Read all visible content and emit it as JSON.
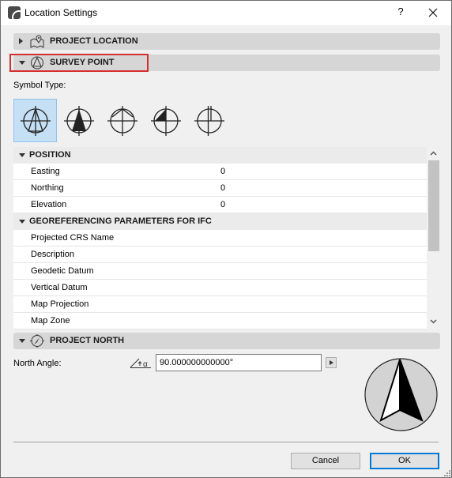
{
  "window": {
    "title": "Location Settings",
    "help_label": "?",
    "close_label": "✕"
  },
  "sections": {
    "project_location": {
      "label": "PROJECT LOCATION",
      "expanded": false,
      "icon": "map-pin-icon"
    },
    "survey_point": {
      "label": "SURVEY POINT",
      "expanded": true,
      "icon": "survey-point-icon",
      "highlighted": true
    },
    "project_north": {
      "label": "PROJECT NORTH",
      "expanded": true,
      "icon": "compass-icon"
    }
  },
  "symbol_type": {
    "label": "Symbol Type:",
    "selected_index": 0,
    "options": [
      {
        "name": "symbol-outline-triangle"
      },
      {
        "name": "symbol-filled-triangle"
      },
      {
        "name": "symbol-roof"
      },
      {
        "name": "symbol-quarter-filled"
      },
      {
        "name": "symbol-double-line"
      }
    ]
  },
  "table": {
    "groups": [
      {
        "label": "POSITION",
        "rows": [
          {
            "name": "Easting",
            "value": "0"
          },
          {
            "name": "Northing",
            "value": "0"
          },
          {
            "name": "Elevation",
            "value": "0"
          }
        ]
      },
      {
        "label": "GEOREFERENCING PARAMETERS FOR IFC",
        "rows": [
          {
            "name": "Projected CRS Name",
            "value": ""
          },
          {
            "name": "Description",
            "value": ""
          },
          {
            "name": "Geodetic Datum",
            "value": ""
          },
          {
            "name": "Vertical Datum",
            "value": ""
          },
          {
            "name": "Map Projection",
            "value": ""
          },
          {
            "name": "Map Zone",
            "value": ""
          }
        ]
      }
    ]
  },
  "north": {
    "label": "North Angle:",
    "angle_symbol": "α",
    "value": "90.000000000000°"
  },
  "buttons": {
    "cancel": "Cancel",
    "ok": "OK"
  },
  "colors": {
    "highlight": "#d32f2f",
    "selection": "#c5dff5",
    "default_button_border": "#0078d7"
  }
}
